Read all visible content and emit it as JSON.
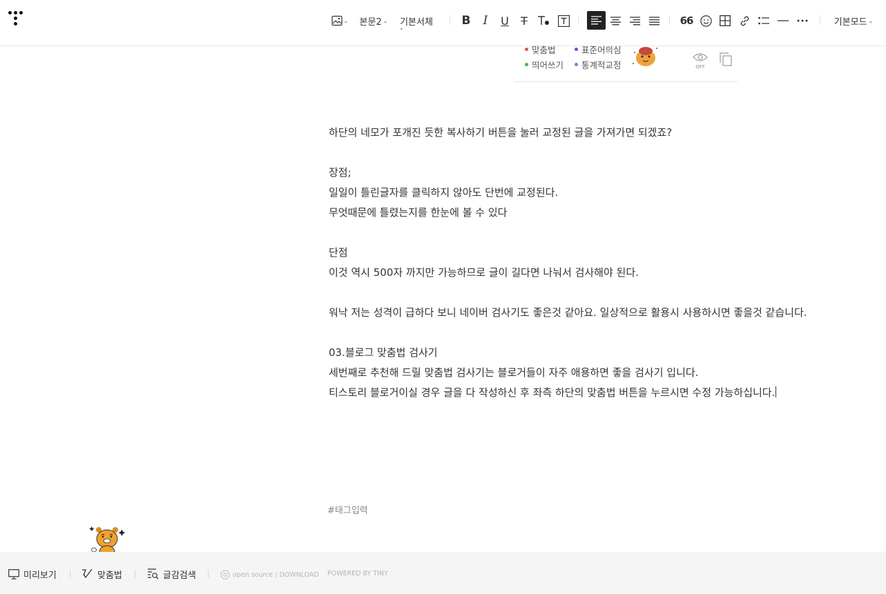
{
  "toolbar": {
    "paragraph_style": "본문2",
    "font_family": "기본서체",
    "mode": "기본모드",
    "quote_label": "66"
  },
  "spell_panel": {
    "legend": [
      {
        "label": "맞춤법",
        "color": "#e0504a"
      },
      {
        "label": "표준어의심",
        "color": "#8a3fd6"
      },
      {
        "label": "띄어쓰기",
        "color": "#4caf50"
      },
      {
        "label": "통계적교정",
        "color": "#5b8fe0"
      }
    ],
    "eye_off": "OFF"
  },
  "editor": {
    "lines": [
      "하단의 네모가 포개진 듯한 복사하기 버튼을 눌러 교정된 글을 가져가면 되겠죠?",
      "",
      "장점;",
      "일일이 틀린글자를 클릭하지 않아도 단번에 교정된다.",
      "무엇때문에 틀렸는지를 한눈에 볼 수 있다",
      "",
      "단점",
      "이것 역시 500자 까지만 가능하므로 글이 길다면 나눠서 검사해야 된다.",
      "",
      "워낙 저는 성격이 급하다 보니 네이버 검사기도 좋은것 같아요. 일상적으로 활용시 사용하시면 좋을것 같습니다.",
      "",
      "03.블로그 맞춤법 검사기",
      "세번째로 추천해 드릴 맞춤법 검사기는 블로거들이 자주 애용하면 좋을 검사기 입니다.",
      "티스토리 블로거이실 경우 글을 다 작성하신 후 좌측 하단의 맞춤법 버튼을 누르시면 수정 가능하십니다."
    ],
    "tag_placeholder": "#태그입력"
  },
  "bottombar": {
    "preview": "미리보기",
    "spellcheck": "맞춤법",
    "word_search": "글감검색",
    "open_source": "open source / DOWNLOAD",
    "powered": "POWERED BY TINY"
  }
}
